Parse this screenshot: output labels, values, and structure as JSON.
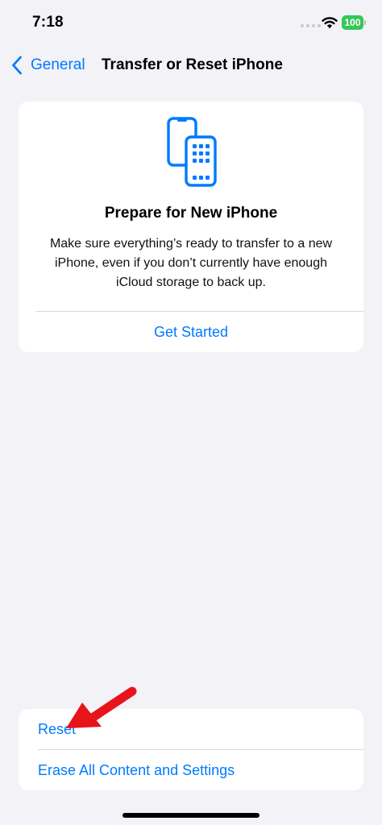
{
  "status_bar": {
    "time": "7:18",
    "battery_level": "100",
    "battery_color": "#34c759"
  },
  "nav": {
    "back_label": "General",
    "title": "Transfer or Reset iPhone"
  },
  "prepare_card": {
    "icon": "two-phones-icon",
    "title": "Prepare for New iPhone",
    "description": "Make sure everything’s ready to transfer to a new iPhone, even if you don’t currently have enough iCloud storage to back up.",
    "action_label": "Get Started"
  },
  "reset_list": {
    "items": [
      {
        "label": "Reset"
      },
      {
        "label": "Erase All Content and Settings"
      }
    ]
  },
  "annotation": {
    "icon": "red-arrow-icon",
    "color": "#e8141b"
  },
  "colors": {
    "accent": "#007aff",
    "background": "#f2f2f7"
  }
}
